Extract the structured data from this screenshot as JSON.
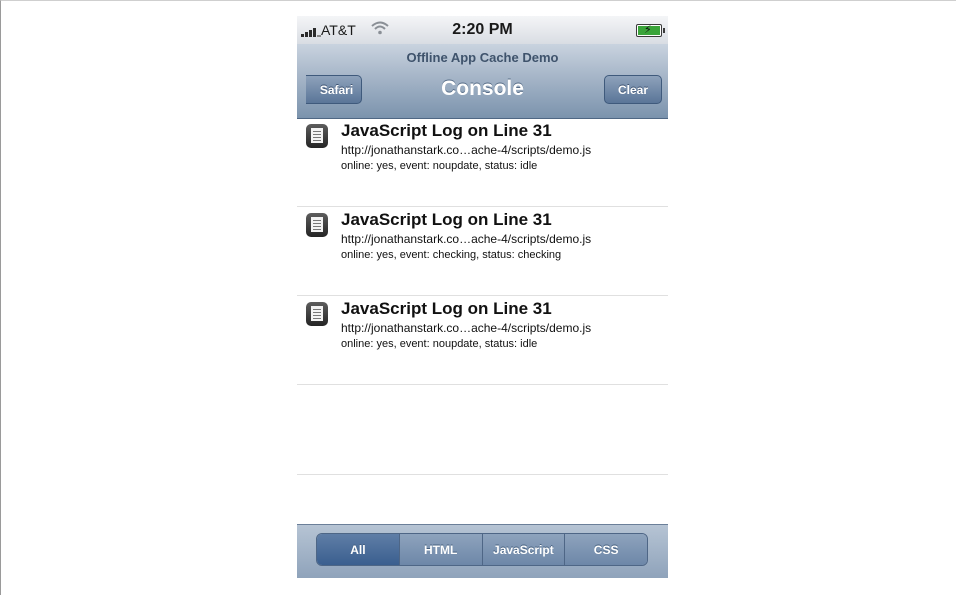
{
  "status_bar": {
    "carrier": "AT&T",
    "time": "2:20 PM",
    "signal_icon": "signal-bars-icon",
    "wifi_icon": "wifi-icon",
    "battery_icon": "battery-charging-icon"
  },
  "nav": {
    "prompt": "Offline App Cache Demo",
    "title": "Console",
    "back_label": "Safari",
    "clear_label": "Clear"
  },
  "log_entries": [
    {
      "title": "JavaScript Log on Line 31",
      "url": "http://jonathanstark.co…ache-4/scripts/demo.js",
      "message": "online: yes, event: noupdate, status: idle"
    },
    {
      "title": "JavaScript Log on Line 31",
      "url": "http://jonathanstark.co…ache-4/scripts/demo.js",
      "message": "online: yes, event: checking, status: checking"
    },
    {
      "title": "JavaScript Log on Line 31",
      "url": "http://jonathanstark.co…ache-4/scripts/demo.js",
      "message": "online: yes, event: noupdate, status: idle"
    }
  ],
  "filter_tabs": [
    {
      "label": "All",
      "selected": true
    },
    {
      "label": "HTML",
      "selected": false
    },
    {
      "label": "JavaScript",
      "selected": false
    },
    {
      "label": "CSS",
      "selected": false
    }
  ],
  "colors": {
    "nav_bar": "#8ea2ba",
    "selected_tab": "#3a5f8f"
  }
}
